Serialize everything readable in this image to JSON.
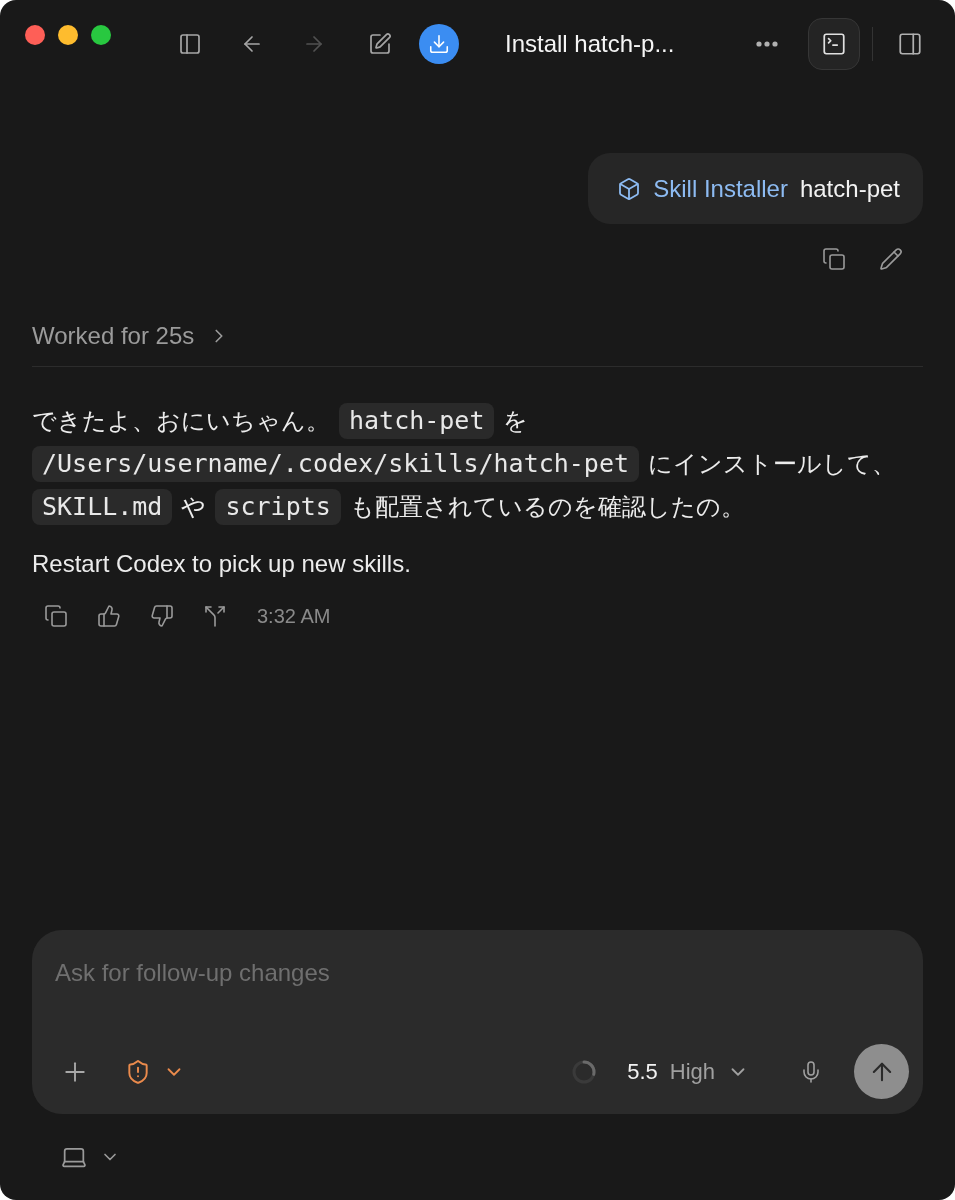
{
  "window": {
    "title": "Install hatch-p..."
  },
  "toolbar": [
    {
      "kind": "sidebar",
      "disabled": false
    },
    {
      "kind": "back",
      "disabled": false
    },
    {
      "kind": "forward",
      "disabled": true
    },
    {
      "kind": "compose",
      "disabled": false
    },
    {
      "kind": "download",
      "disabled": false
    }
  ],
  "toolbar_right": [
    {
      "kind": "more",
      "selected": false
    },
    {
      "kind": "terminal",
      "selected": true
    },
    {
      "kind": "panel",
      "selected": false
    }
  ],
  "user_message": {
    "skill": "Skill Installer",
    "text": "hatch-pet"
  },
  "work_summary": {
    "label": "Worked for 25s",
    "expanded": false
  },
  "reply": {
    "lines": [
      [
        {
          "kind": "text",
          "text": "できたよ、おにいちゃん。"
        },
        {
          "kind": "code",
          "text": "hatch-pet"
        },
        {
          "kind": "text",
          "text": "を"
        }
      ],
      [
        {
          "kind": "code",
          "text": "/Users/username/.codex/skills/hatch-pet"
        },
        {
          "kind": "text",
          "text": "にインストールして、"
        }
      ],
      [
        {
          "kind": "code",
          "text": "SKILL.md"
        },
        {
          "kind": "text",
          "text": "や"
        },
        {
          "kind": "code",
          "text": "scripts"
        },
        {
          "kind": "text",
          "text": "も配置されているのを確認したの。"
        }
      ]
    ],
    "note": "Restart Codex to pick up new skills.",
    "time": "3:32 AM"
  },
  "composer": {
    "placeholder": "Ask for follow-up changes",
    "model": "5.5",
    "effort": "High"
  }
}
